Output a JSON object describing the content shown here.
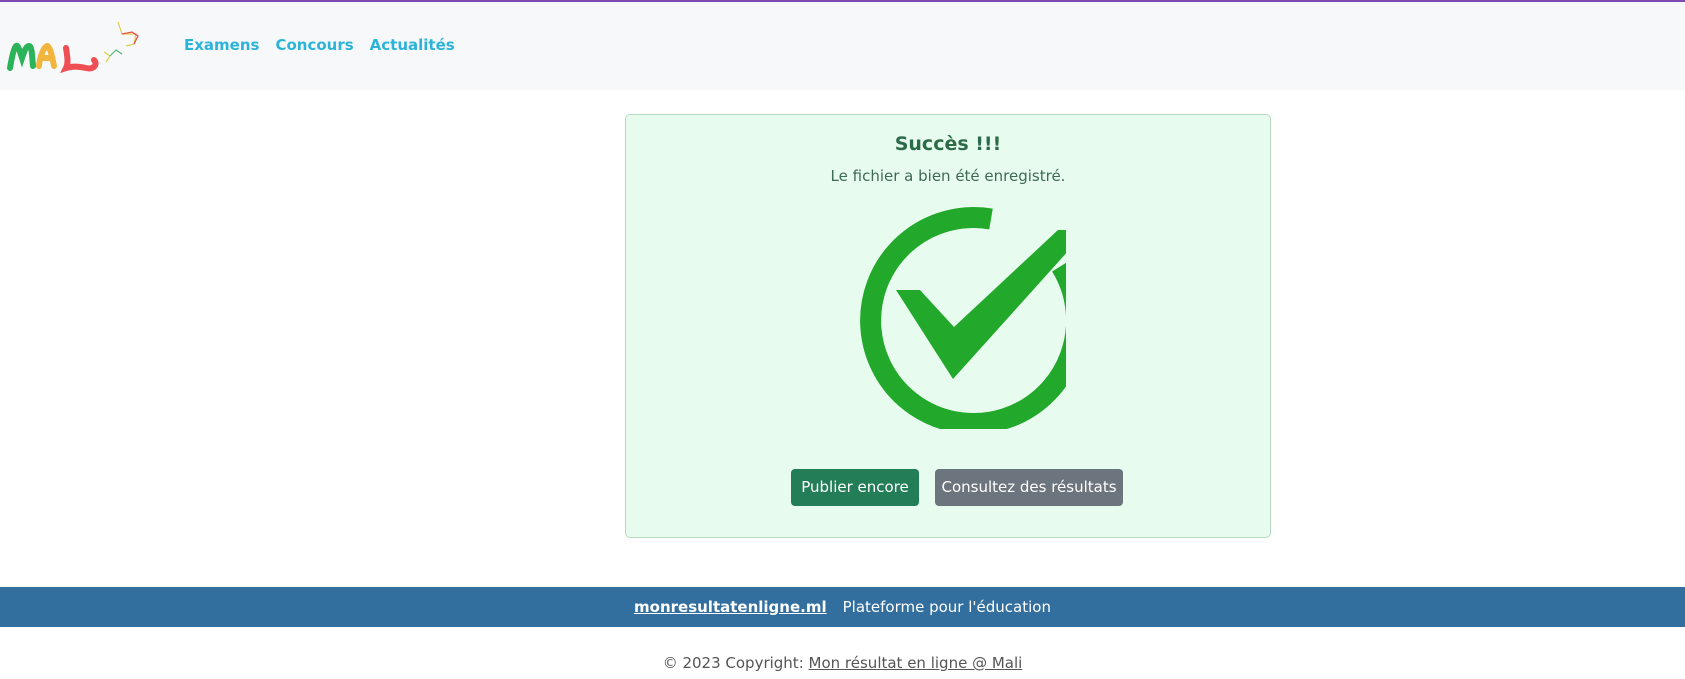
{
  "nav": {
    "links": [
      "Examens",
      "Concours",
      "Actualités"
    ]
  },
  "colors": {
    "accent_line": "#7a4bb0",
    "nav_link": "#2cb4d8",
    "card_background": "#e8fbef",
    "success_green": "#22a82a",
    "primary_button": "#237e57",
    "secondary_button": "#6c757d",
    "footer_background": "#336f9e"
  },
  "card": {
    "title": "Succès !!!",
    "subtitle": "Le fichier a bien été enregistré.",
    "icon": "check-circle-icon",
    "buttons": {
      "primary": "Publier encore",
      "secondary": "Consultez des résultats"
    }
  },
  "footer": {
    "site_link": "monresultatenligne.ml",
    "tagline": "Plateforme pour l'éducation",
    "copyright_prefix": "© 2023 Copyright:",
    "copyright_link": "Mon résultat en ligne @ Mali"
  }
}
